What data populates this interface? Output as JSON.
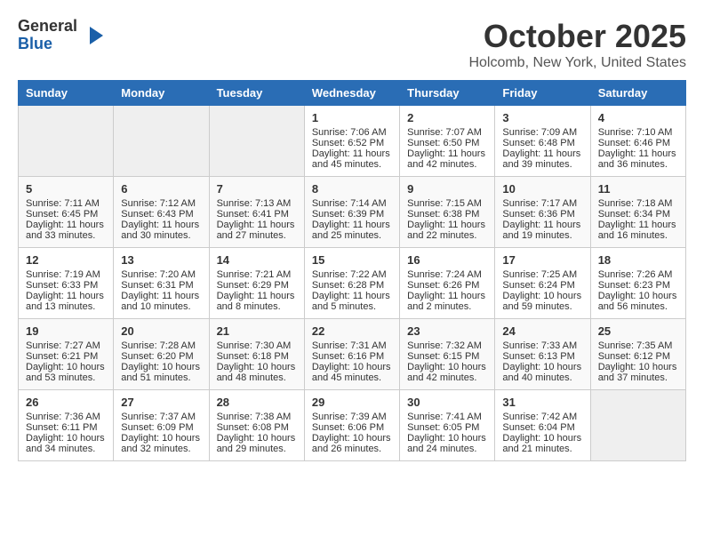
{
  "header": {
    "logo_general": "General",
    "logo_blue": "Blue",
    "month": "October 2025",
    "location": "Holcomb, New York, United States"
  },
  "days_of_week": [
    "Sunday",
    "Monday",
    "Tuesday",
    "Wednesday",
    "Thursday",
    "Friday",
    "Saturday"
  ],
  "weeks": [
    [
      {
        "day": "",
        "info": ""
      },
      {
        "day": "",
        "info": ""
      },
      {
        "day": "",
        "info": ""
      },
      {
        "day": "1",
        "info": "Sunrise: 7:06 AM\nSunset: 6:52 PM\nDaylight: 11 hours and 45 minutes."
      },
      {
        "day": "2",
        "info": "Sunrise: 7:07 AM\nSunset: 6:50 PM\nDaylight: 11 hours and 42 minutes."
      },
      {
        "day": "3",
        "info": "Sunrise: 7:09 AM\nSunset: 6:48 PM\nDaylight: 11 hours and 39 minutes."
      },
      {
        "day": "4",
        "info": "Sunrise: 7:10 AM\nSunset: 6:46 PM\nDaylight: 11 hours and 36 minutes."
      }
    ],
    [
      {
        "day": "5",
        "info": "Sunrise: 7:11 AM\nSunset: 6:45 PM\nDaylight: 11 hours and 33 minutes."
      },
      {
        "day": "6",
        "info": "Sunrise: 7:12 AM\nSunset: 6:43 PM\nDaylight: 11 hours and 30 minutes."
      },
      {
        "day": "7",
        "info": "Sunrise: 7:13 AM\nSunset: 6:41 PM\nDaylight: 11 hours and 27 minutes."
      },
      {
        "day": "8",
        "info": "Sunrise: 7:14 AM\nSunset: 6:39 PM\nDaylight: 11 hours and 25 minutes."
      },
      {
        "day": "9",
        "info": "Sunrise: 7:15 AM\nSunset: 6:38 PM\nDaylight: 11 hours and 22 minutes."
      },
      {
        "day": "10",
        "info": "Sunrise: 7:17 AM\nSunset: 6:36 PM\nDaylight: 11 hours and 19 minutes."
      },
      {
        "day": "11",
        "info": "Sunrise: 7:18 AM\nSunset: 6:34 PM\nDaylight: 11 hours and 16 minutes."
      }
    ],
    [
      {
        "day": "12",
        "info": "Sunrise: 7:19 AM\nSunset: 6:33 PM\nDaylight: 11 hours and 13 minutes."
      },
      {
        "day": "13",
        "info": "Sunrise: 7:20 AM\nSunset: 6:31 PM\nDaylight: 11 hours and 10 minutes."
      },
      {
        "day": "14",
        "info": "Sunrise: 7:21 AM\nSunset: 6:29 PM\nDaylight: 11 hours and 8 minutes."
      },
      {
        "day": "15",
        "info": "Sunrise: 7:22 AM\nSunset: 6:28 PM\nDaylight: 11 hours and 5 minutes."
      },
      {
        "day": "16",
        "info": "Sunrise: 7:24 AM\nSunset: 6:26 PM\nDaylight: 11 hours and 2 minutes."
      },
      {
        "day": "17",
        "info": "Sunrise: 7:25 AM\nSunset: 6:24 PM\nDaylight: 10 hours and 59 minutes."
      },
      {
        "day": "18",
        "info": "Sunrise: 7:26 AM\nSunset: 6:23 PM\nDaylight: 10 hours and 56 minutes."
      }
    ],
    [
      {
        "day": "19",
        "info": "Sunrise: 7:27 AM\nSunset: 6:21 PM\nDaylight: 10 hours and 53 minutes."
      },
      {
        "day": "20",
        "info": "Sunrise: 7:28 AM\nSunset: 6:20 PM\nDaylight: 10 hours and 51 minutes."
      },
      {
        "day": "21",
        "info": "Sunrise: 7:30 AM\nSunset: 6:18 PM\nDaylight: 10 hours and 48 minutes."
      },
      {
        "day": "22",
        "info": "Sunrise: 7:31 AM\nSunset: 6:16 PM\nDaylight: 10 hours and 45 minutes."
      },
      {
        "day": "23",
        "info": "Sunrise: 7:32 AM\nSunset: 6:15 PM\nDaylight: 10 hours and 42 minutes."
      },
      {
        "day": "24",
        "info": "Sunrise: 7:33 AM\nSunset: 6:13 PM\nDaylight: 10 hours and 40 minutes."
      },
      {
        "day": "25",
        "info": "Sunrise: 7:35 AM\nSunset: 6:12 PM\nDaylight: 10 hours and 37 minutes."
      }
    ],
    [
      {
        "day": "26",
        "info": "Sunrise: 7:36 AM\nSunset: 6:11 PM\nDaylight: 10 hours and 34 minutes."
      },
      {
        "day": "27",
        "info": "Sunrise: 7:37 AM\nSunset: 6:09 PM\nDaylight: 10 hours and 32 minutes."
      },
      {
        "day": "28",
        "info": "Sunrise: 7:38 AM\nSunset: 6:08 PM\nDaylight: 10 hours and 29 minutes."
      },
      {
        "day": "29",
        "info": "Sunrise: 7:39 AM\nSunset: 6:06 PM\nDaylight: 10 hours and 26 minutes."
      },
      {
        "day": "30",
        "info": "Sunrise: 7:41 AM\nSunset: 6:05 PM\nDaylight: 10 hours and 24 minutes."
      },
      {
        "day": "31",
        "info": "Sunrise: 7:42 AM\nSunset: 6:04 PM\nDaylight: 10 hours and 21 minutes."
      },
      {
        "day": "",
        "info": ""
      }
    ]
  ]
}
